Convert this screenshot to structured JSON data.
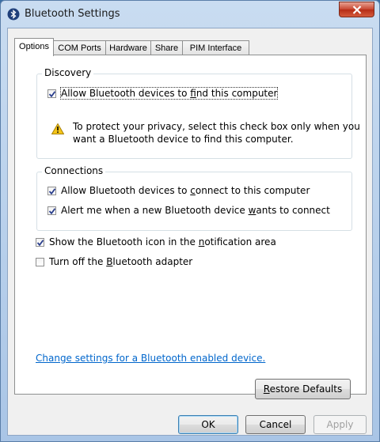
{
  "window": {
    "title": "Bluetooth Settings"
  },
  "tabs": [
    {
      "label": "Options",
      "active": true
    },
    {
      "label": "COM Ports",
      "active": false
    },
    {
      "label": "Hardware",
      "active": false
    },
    {
      "label": "Share",
      "active": false
    },
    {
      "label": "PIM Interface",
      "active": false
    }
  ],
  "discovery": {
    "group_label": "Discovery",
    "allow_find": {
      "pre": "Allow Bluetooth devices to ",
      "key": "f",
      "post": "ind this computer",
      "checked": true
    },
    "warning": "To protect your privacy, select this check box only when you want a Bluetooth device to find this computer."
  },
  "connections": {
    "group_label": "Connections",
    "allow_connect": {
      "pre": "Allow Bluetooth devices to ",
      "key": "c",
      "post": "onnect to this computer",
      "checked": true
    },
    "alert_connect": {
      "pre": "Alert me when a new Bluetooth device ",
      "key": "w",
      "post": "ants to connect",
      "checked": true
    }
  },
  "show_icon": {
    "pre": "Show the Bluetooth icon in the ",
    "key": "n",
    "post": "otification area",
    "checked": true
  },
  "turn_off": {
    "pre": "Turn off the ",
    "key": "B",
    "post": "luetooth adapter",
    "checked": false
  },
  "link_text": "Change settings for a Bluetooth enabled device.",
  "buttons": {
    "restore": {
      "key": "R",
      "post": "estore Defaults"
    },
    "ok": "OK",
    "cancel": "Cancel",
    "apply": "Apply"
  },
  "colors": {
    "link": "#0066cc",
    "title_bar": "#c9dcf1",
    "close_button": "#c7452f"
  },
  "icons": [
    "bluetooth-icon",
    "close-icon",
    "warning-icon",
    "checkmark-icon"
  ]
}
